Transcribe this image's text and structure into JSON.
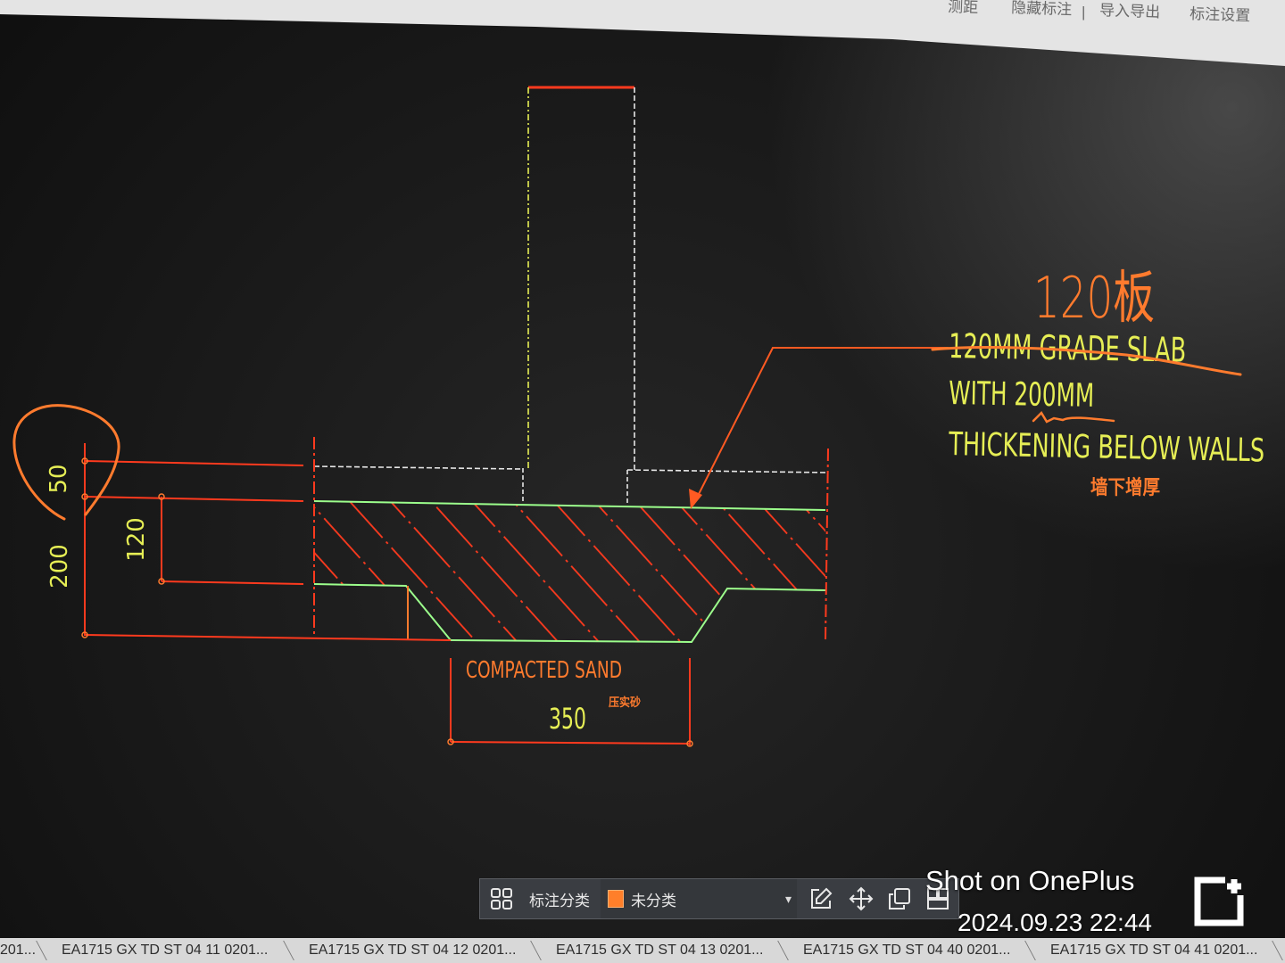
{
  "top_toolbar": {
    "items": [
      "测距",
      "隐藏标注",
      "导入导出",
      "标注设置"
    ]
  },
  "drawing": {
    "note_handwritten": "120板",
    "note_lines": [
      "120MM GRADE SLAB",
      "WITH 200MM",
      "THICKENING BELOW WALLS"
    ],
    "note_cn": "墙下增厚",
    "sand_label": "COMPACTED SAND",
    "sand_cn": "压实砂",
    "dim_width": "350",
    "dim_top": "50",
    "dim_slab": "120",
    "dim_total": "200"
  },
  "bottom_toolbar": {
    "category_label": "标注分类",
    "category_value": "未分类",
    "icons": [
      "grid-icon",
      "chevron-down-icon",
      "edit-icon",
      "move-icon",
      "copy-icon",
      "paste-icon"
    ]
  },
  "watermark": {
    "brand": "Shot on OnePlus",
    "timestamp": "2024.09.23 22:44"
  },
  "tabs": [
    {
      "label": "201..."
    },
    {
      "label": "EA1715 GX TD ST 04 11 0201..."
    },
    {
      "label": "EA1715 GX TD ST 04 12 0201..."
    },
    {
      "label": "EA1715 GX TD ST 04 13 0201..."
    },
    {
      "label": "EA1715 GX TD ST 04 40 0201..."
    },
    {
      "label": "EA1715 GX TD ST 04 41 0201..."
    }
  ],
  "colors": {
    "canvas": "#141414",
    "cad_yellow": "#e6ee55",
    "cad_red": "#ff3a1e",
    "cad_orange": "#ff7b2e",
    "cad_green": "#9cff8c",
    "cad_white": "#e6e6e6",
    "swatch": "#ff7f2a",
    "toolbar_bg": "#3a3d42",
    "tabbar_bg": "#d8d8d8"
  }
}
